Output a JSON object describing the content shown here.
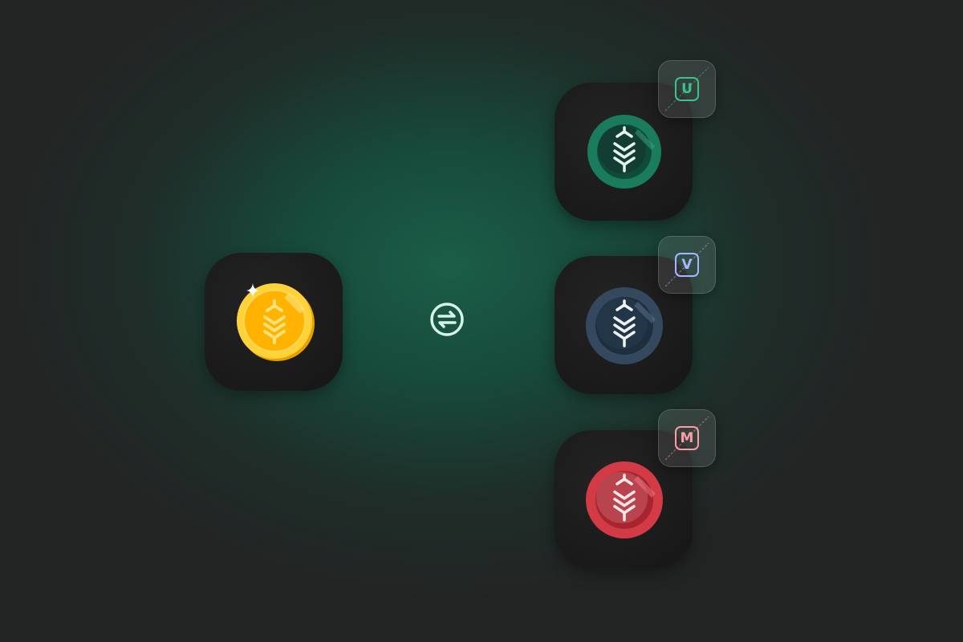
{
  "source_token": {
    "name": "gold-coin",
    "icon": "wheat-coin-icon",
    "accent": "#ffc21a"
  },
  "swap": {
    "icon": "swap-arrows-icon",
    "color": "#d4f5e8"
  },
  "variants": [
    {
      "badge": "U",
      "badge_color": "#39c48a",
      "coin_color": "#1b7c5d",
      "icon": "wheat-coin-icon"
    },
    {
      "badge": "V",
      "badge_color": "#a9b6ff",
      "coin_color": "#34495e",
      "icon": "wheat-coin-icon"
    },
    {
      "badge": "M",
      "badge_color": "#ff9aa8",
      "coin_color": "#d23a45",
      "icon": "wheat-coin-icon"
    }
  ]
}
